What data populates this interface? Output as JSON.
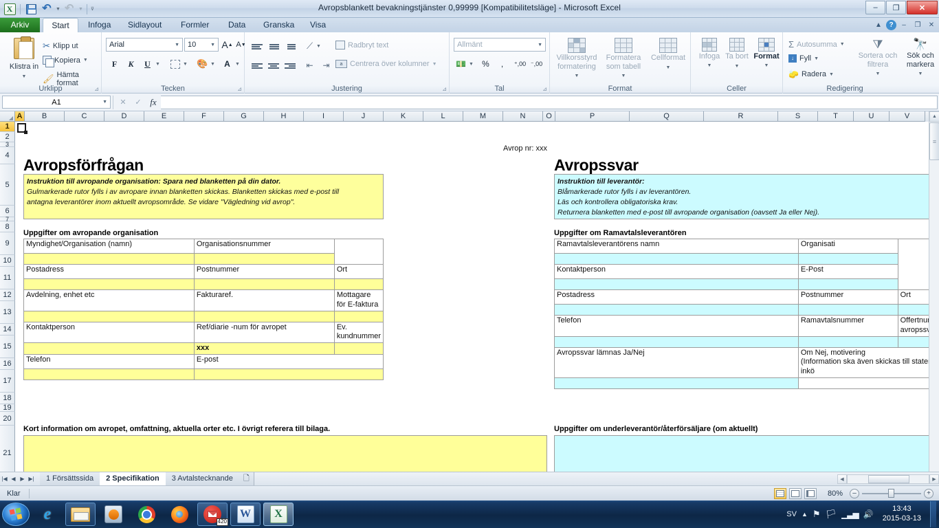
{
  "window": {
    "title": "Avropsblankett bevakningstjänster 0,99999  [Kompatibilitetsläge]  -  Microsoft Excel",
    "minimize": "–",
    "restore": "❐",
    "close": "✕"
  },
  "quick_access": {
    "save": "save-icon",
    "undo": "undo-icon",
    "redo": "redo-icon",
    "more": "▾"
  },
  "ribbon": {
    "tabs": [
      {
        "label": "Arkiv",
        "active": false,
        "file": true
      },
      {
        "label": "Start",
        "active": true
      },
      {
        "label": "Infoga",
        "active": false
      },
      {
        "label": "Sidlayout",
        "active": false
      },
      {
        "label": "Formler",
        "active": false
      },
      {
        "label": "Data",
        "active": false
      },
      {
        "label": "Granska",
        "active": false
      },
      {
        "label": "Visa",
        "active": false
      }
    ],
    "help_buttons": [
      "▲",
      "?",
      "–",
      "❐",
      "✕"
    ],
    "groups": {
      "clipboard": {
        "title": "Urklipp",
        "paste": "Klistra in",
        "cut": "Klipp ut",
        "copy": "Kopiera",
        "format_painter": "Hämta format"
      },
      "font": {
        "title": "Tecken",
        "font_name": "Arial",
        "font_size": "10",
        "grow": "A",
        "shrink": "A",
        "bold": "F",
        "italic": "K",
        "underline": "U",
        "borders": "borders-icon",
        "fill_color": "fill-color-icon",
        "font_color": "A"
      },
      "alignment": {
        "title": "Justering",
        "wrap_text": "Radbryt text",
        "merge_center": "Centrera över kolumner",
        "orientation": "orientation-icon",
        "decrease_indent": "decrease-indent-icon",
        "increase_indent": "increase-indent-icon"
      },
      "number": {
        "title": "Tal",
        "format": "Allmänt",
        "currency": "currency-icon",
        "percent": "%",
        "comma": ",",
        "increase_decimal": ",00",
        "decrease_decimal": ",00"
      },
      "styles": {
        "title": "Format",
        "conditional": "Villkorsstyrd formatering",
        "table": "Formatera som tabell",
        "cell_styles": "Cellformat"
      },
      "cells": {
        "title": "Celler",
        "insert": "Infoga",
        "delete": "Ta bort",
        "format": "Format"
      },
      "editing": {
        "title": "Redigering",
        "autosum": "Autosumma",
        "fill": "Fyll",
        "clear": "Radera",
        "sort_filter": "Sortera och filtrera",
        "find_select": "Sök och markera"
      }
    }
  },
  "formula_bar": {
    "name_box": "A1",
    "formula": ""
  },
  "grid": {
    "columns": [
      "A",
      "B",
      "C",
      "D",
      "E",
      "F",
      "G",
      "H",
      "I",
      "J",
      "K",
      "L",
      "M",
      "N",
      "O",
      "P",
      "Q",
      "R",
      "S",
      "T",
      "U",
      "V"
    ],
    "selected_column": "A",
    "rows": [
      "1",
      "2",
      "3",
      "4",
      "5",
      "6",
      "7",
      "8",
      "9",
      "10",
      "11",
      "12",
      "13",
      "14",
      "15",
      "16",
      "17",
      "18",
      "19",
      "20",
      "21"
    ],
    "selected_row": "1",
    "active_cell": "A1"
  },
  "sheet_content": {
    "avrop_nr": "Avrop nr: xxx",
    "left": {
      "title": "Avropsförfrågan",
      "instruction_bold": "Instruktion till avropande organisation: Spara ned blanketten på din dator.",
      "instruction_lines": [
        "Gulmarkerade rutor fylls i av avropare innan blanketten skickas. Blanketten skickas med e-post till",
        "antagna leverantörer inom aktuellt avropsområde. Se vidare \"Vägledning vid avrop\"."
      ],
      "section_heading": "Uppgifter om avropande organisation",
      "table_rows": [
        [
          "Myndighet/Organisation (namn)",
          "Organisationsnummer"
        ],
        [
          "Postadress",
          "Postnummer",
          "Ort"
        ],
        [
          "Avdelning, enhet etc",
          "Fakturaref.",
          "Mottagare för E-faktura"
        ],
        [
          "Kontaktperson",
          "Ref/diarie -num för avropet",
          "Ev. kundnummer"
        ],
        [
          "Telefon",
          "E-post"
        ]
      ],
      "filled_values": {
        "ref_diarie": "xxx"
      },
      "bottom_heading": "Kort information om avropet, omfattning, aktuella orter etc. I övrigt referera till bilaga."
    },
    "right": {
      "title": "Avropssvar",
      "instruction_bold": "Instruktion till leverantör:",
      "instruction_lines": [
        "Blåmarkerade rutor fylls i av leverantören.",
        "Läs och kontrollera obligatoriska krav.",
        "Returnera blanketten med e-post till avropande organisation (oavsett Ja eller Nej)."
      ],
      "section_heading": "Uppgifter om Ramavtalsleverantören",
      "table_rows": [
        [
          "Ramavtalsleverantörens namn",
          "Organisati"
        ],
        [
          "Kontaktperson",
          "E-Post"
        ],
        [
          "Postadress",
          "Postnummer",
          "Ort"
        ],
        [
          "Telefon",
          "Ramavtalsnummer",
          "Offertnumr\navropssva"
        ],
        [
          "Avropssvar lämnas Ja/Nej",
          "Om Nej, motivering\n(Information ska även skickas till statens inkö"
        ]
      ],
      "bottom_heading": "Uppgifter om underleverantör/återförsäljare (om aktuellt)"
    }
  },
  "sheet_tabs": {
    "nav": [
      "|◀",
      "◀",
      "▶",
      "▶|"
    ],
    "tabs": [
      {
        "label": "1 Försättssida",
        "active": false
      },
      {
        "label": "2 Specifikation",
        "active": true
      },
      {
        "label": "3 Avtalstecknande",
        "active": false
      }
    ],
    "new_sheet": "new-sheet-icon"
  },
  "status_bar": {
    "text": "Klar",
    "views": [
      "normal-view",
      "page-layout-view",
      "page-break-view"
    ],
    "active_view": "normal-view",
    "zoom": "80%",
    "zoom_out": "–",
    "zoom_in": "+"
  },
  "taskbar": {
    "start": "windows-start-orb",
    "items": [
      {
        "name": "internet-explorer",
        "framed": false
      },
      {
        "name": "file-explorer",
        "framed": true
      },
      {
        "name": "windows-media-player",
        "framed": false
      },
      {
        "name": "google-chrome",
        "framed": false
      },
      {
        "name": "mozilla-firefox",
        "framed": false
      },
      {
        "name": "mail-client",
        "framed": true,
        "badge": "420"
      },
      {
        "name": "microsoft-word",
        "framed": true
      },
      {
        "name": "microsoft-excel",
        "framed": true,
        "active": true
      }
    ],
    "tray": {
      "language": "SV",
      "time": "13:43",
      "date": "2015-03-13"
    }
  },
  "colors": {
    "yellow_fill": "#ffff99",
    "blue_fill": "#ccfbff",
    "excel_green": "#217346",
    "selection": "#f5c23c"
  }
}
